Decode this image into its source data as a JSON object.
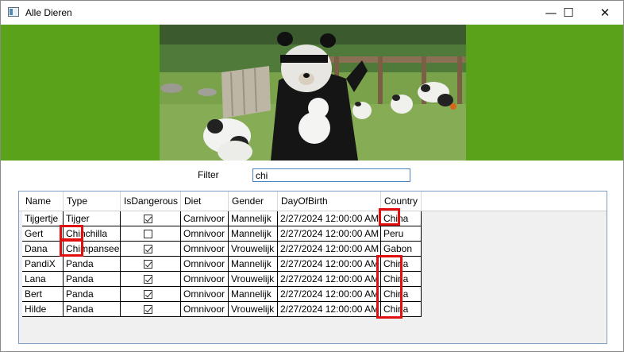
{
  "window": {
    "title": "Alle Dieren"
  },
  "controls": {
    "minimize": "—",
    "maximize": "☐",
    "close": "✕"
  },
  "filter": {
    "label": "Filter",
    "value": "chi"
  },
  "grid": {
    "columns": [
      "Name",
      "Type",
      "IsDangerous",
      "Diet",
      "Gender",
      "DayOfBirth",
      "Country"
    ],
    "rows": [
      {
        "name": "Tijgertje",
        "type": "Tijger",
        "dangerous": true,
        "diet": "Carnivoor",
        "gender": "Mannelijk",
        "dob": "2/27/2024 12:00:00 AM",
        "country": "China"
      },
      {
        "name": "Gert",
        "type": "Chinchilla",
        "dangerous": false,
        "diet": "Omnivoor",
        "gender": "Mannelijk",
        "dob": "2/27/2024 12:00:00 AM",
        "country": "Peru"
      },
      {
        "name": "Dana",
        "type": "Chimpansee",
        "dangerous": true,
        "diet": "Omnivoor",
        "gender": "Vrouwelijk",
        "dob": "2/27/2024 12:00:00 AM",
        "country": "Gabon"
      },
      {
        "name": "PandiX",
        "type": "Panda",
        "dangerous": true,
        "diet": "Omnivoor",
        "gender": "Mannelijk",
        "dob": "2/27/2024 12:00:00 AM",
        "country": "China"
      },
      {
        "name": "Lana",
        "type": "Panda",
        "dangerous": true,
        "diet": "Omnivoor",
        "gender": "Vrouwelijk",
        "dob": "2/27/2024 12:00:00 AM",
        "country": "China"
      },
      {
        "name": "Bert",
        "type": "Panda",
        "dangerous": true,
        "diet": "Omnivoor",
        "gender": "Mannelijk",
        "dob": "2/27/2024 12:00:00 AM",
        "country": "China"
      },
      {
        "name": "Hilde",
        "type": "Panda",
        "dangerous": true,
        "diet": "Omnivoor",
        "gender": "Vrouwelijk",
        "dob": "2/27/2024 12:00:00 AM",
        "country": "China"
      }
    ]
  },
  "colors": {
    "banner": "#5aa21a",
    "highlight": "#e01010"
  }
}
